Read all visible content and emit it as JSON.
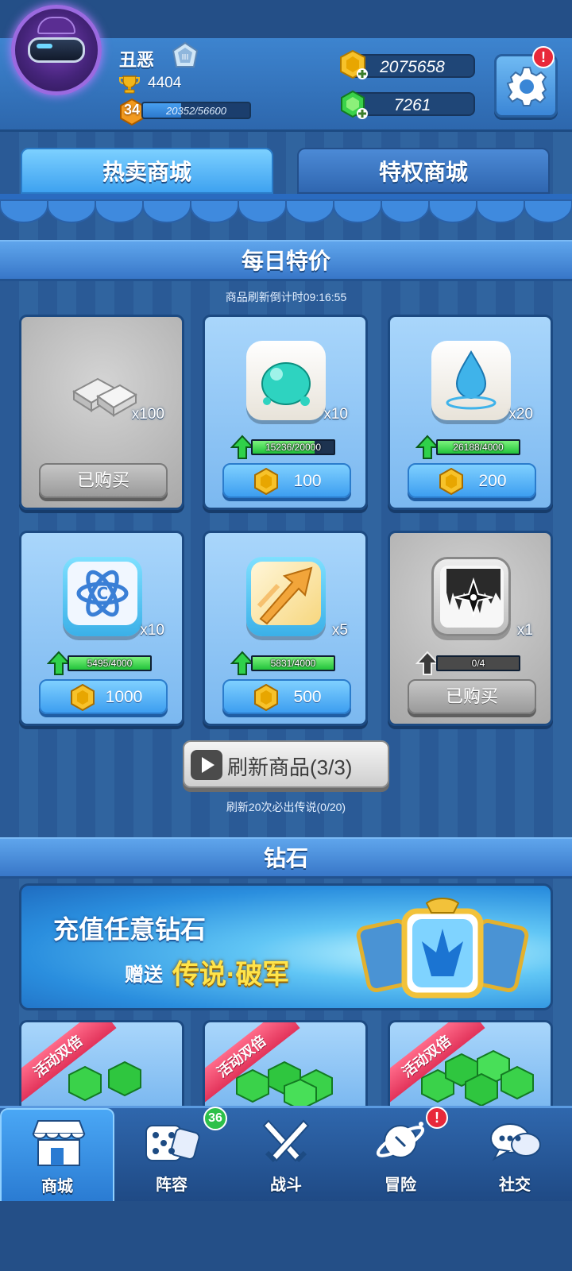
{
  "player": {
    "name": "丑恶",
    "trophies": "4404",
    "level": "34",
    "xp_text": "20352/56600",
    "xp_fraction": 0.36
  },
  "currency": {
    "gold": "2075658",
    "gems": "7261"
  },
  "settings": {
    "alert": "!"
  },
  "tabs": [
    {
      "label": "热卖商城",
      "active": true
    },
    {
      "label": "特权商城",
      "active": false
    }
  ],
  "daily": {
    "title": "每日特价",
    "countdown": "商品刷新倒计时09:16:55",
    "items": [
      {
        "name": "silver-ingots",
        "qty": "x100",
        "status": "已购买",
        "bought": true
      },
      {
        "name": "slime-card",
        "qty": "x10",
        "progress": "15236/20000",
        "progress_fraction": 0.76,
        "price": "100",
        "bought": false
      },
      {
        "name": "water-drop-card",
        "qty": "x20",
        "progress": "26188/4000",
        "progress_fraction": 1.0,
        "price": "200",
        "bought": false
      },
      {
        "name": "atom-card",
        "qty": "x10",
        "progress": "5495/4000",
        "progress_fraction": 1.0,
        "price": "1000",
        "bought": false
      },
      {
        "name": "arrow-card",
        "qty": "x5",
        "progress": "5831/4000",
        "progress_fraction": 1.0,
        "price": "500",
        "bought": false
      },
      {
        "name": "shuriken-card",
        "qty": "x1",
        "progress": "0/4",
        "progress_fraction": 0.0,
        "status": "已购买",
        "bought": true
      }
    ],
    "refresh_label": "刷新商品(3/3)",
    "refresh_note": "刷新20次必出传说(0/20)"
  },
  "diamonds": {
    "title": "钻石",
    "banner_line1": "充值任意钻石",
    "banner_line2a": "赠送",
    "banner_line2b": "传说·破军",
    "ribbons": [
      "活动双倍",
      "活动双倍",
      "活动双倍"
    ]
  },
  "nav": [
    {
      "label": "商城",
      "icon": "shop-icon",
      "active": true
    },
    {
      "label": "阵容",
      "icon": "dice-icon",
      "badge": "36"
    },
    {
      "label": "战斗",
      "icon": "swords-icon"
    },
    {
      "label": "冒险",
      "icon": "planet-icon",
      "alert": "!"
    },
    {
      "label": "社交",
      "icon": "chat-icon"
    }
  ],
  "colors": {
    "accent_blue": "#3ea2f0",
    "gold": "#f2b619",
    "gem_green": "#2fc63f",
    "alert_red": "#e8283a"
  }
}
